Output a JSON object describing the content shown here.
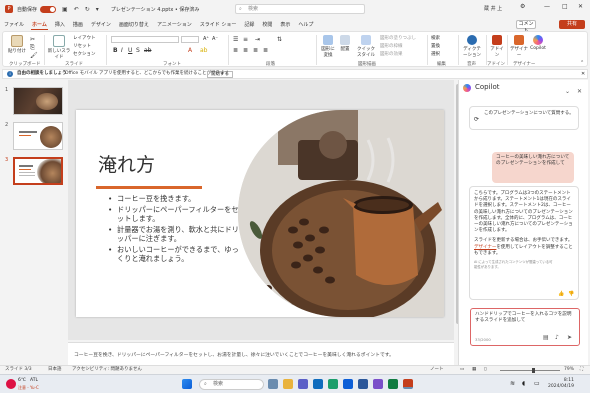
{
  "titlebar": {
    "autosave_label": "自動保存",
    "autosave_state": "オン",
    "document": "プレゼンテーション 4.pptx • 保存済み",
    "search_placeholder": "検索",
    "user": "蔵 井 上"
  },
  "tabs": [
    "ファイル",
    "ホーム",
    "挿入",
    "描画",
    "デザイン",
    "画面切り替え",
    "アニメーション",
    "スライド ショー",
    "記録",
    "校閲",
    "表示",
    "ヘルプ"
  ],
  "active_tab": "ホーム",
  "header_buttons": {
    "comments": "コメント",
    "share": "共有"
  },
  "ribbon": {
    "groups": [
      "クリップボード",
      "スライド",
      "フォント",
      "段落",
      "図形描画",
      "編集",
      "音声",
      "アドイン",
      "デザイナー"
    ],
    "buttons": {
      "paste": "貼り付け",
      "new_slide": "新しいスライド",
      "layout": "レイアウト",
      "reset": "リセット",
      "section": "セクション",
      "convert": "図形に変換",
      "arrange": "配置",
      "quick_styles": "クイックスタイル",
      "shape_fill": "図形の塗りつぶし",
      "shape_outline": "図形の枠線",
      "shape_effects": "図形の効果",
      "find": "検索",
      "replace": "置換",
      "select": "選択",
      "dictate": "ディクテーション",
      "addins": "アドイン",
      "designer": "デザイナー",
      "copilot": "Copilot"
    }
  },
  "infobar": {
    "title": "自由の相談をしましょう",
    "message": "Office モバイル アプリを使用すると、どこからでも作業を続けることができます",
    "button": "開始する"
  },
  "thumbnails": [
    "1",
    "2",
    "3"
  ],
  "slide": {
    "title": "淹れ方",
    "bullets": [
      "コーヒー豆を挽きます。",
      "ドリッパーにペーパーフィルターをセットします。",
      "計量器でお湯を測り、軟水と共にドリッパーに注ぎます。",
      "おいしいコーヒーができるまで、ゆっくりと淹れましょう。"
    ]
  },
  "notes": "コーヒー豆を挽き、ドリッパーにペーパーフィルターをセットし、お湯を計量し、徐々に注いでいくことでコーヒーを美味しく淹れるポイントです。",
  "copilot": {
    "title": "Copilot",
    "prev_card": "このプレゼンテーションについて質問する。",
    "user_message": "コーヒーの美味しい淹れ方についてのプレゼンテーションを作成して",
    "response_p1": "こちらです。プログラムは3つのステートメントから成ります。ステートメント1は現在のスライドを選択します。ステートメント2は、コーヒーの美味しい淹れ方についてのプレゼンテーションを作成します。全体的に、プログラムは、コーヒーの美味しい淹れ方についてのプレゼンテーションを作成します。",
    "response_p2_pre": "スライドを更新する場合は、お手伝いできます。",
    "response_link": "デザイナー",
    "response_p2_post": "を使用してレイアウトを調整することもできます。",
    "disclaimer": "AI によって生成されたコンテンツが間違っている可能性があります。",
    "input_text": "ハンドドリップでコーヒーを入れるコツを説明するスライドを追加して",
    "input_counter": "33/2000"
  },
  "statusbar": {
    "slide": "スライド 3/3",
    "language": "日本語",
    "accessibility": "アクセシビリティ: 問題ありません",
    "notes": "ノート",
    "zoom": "79%"
  },
  "taskbar": {
    "weather_temp": "6℃",
    "weather_desc": "ATL",
    "weather_label": "注意 - Yu-C",
    "search": "検索",
    "time": "8:11",
    "date": "2024/04/19"
  },
  "colors": {
    "accent": "#c43e1c",
    "title_rule": "#d9662b",
    "user_bubble": "#f6d6cd"
  }
}
